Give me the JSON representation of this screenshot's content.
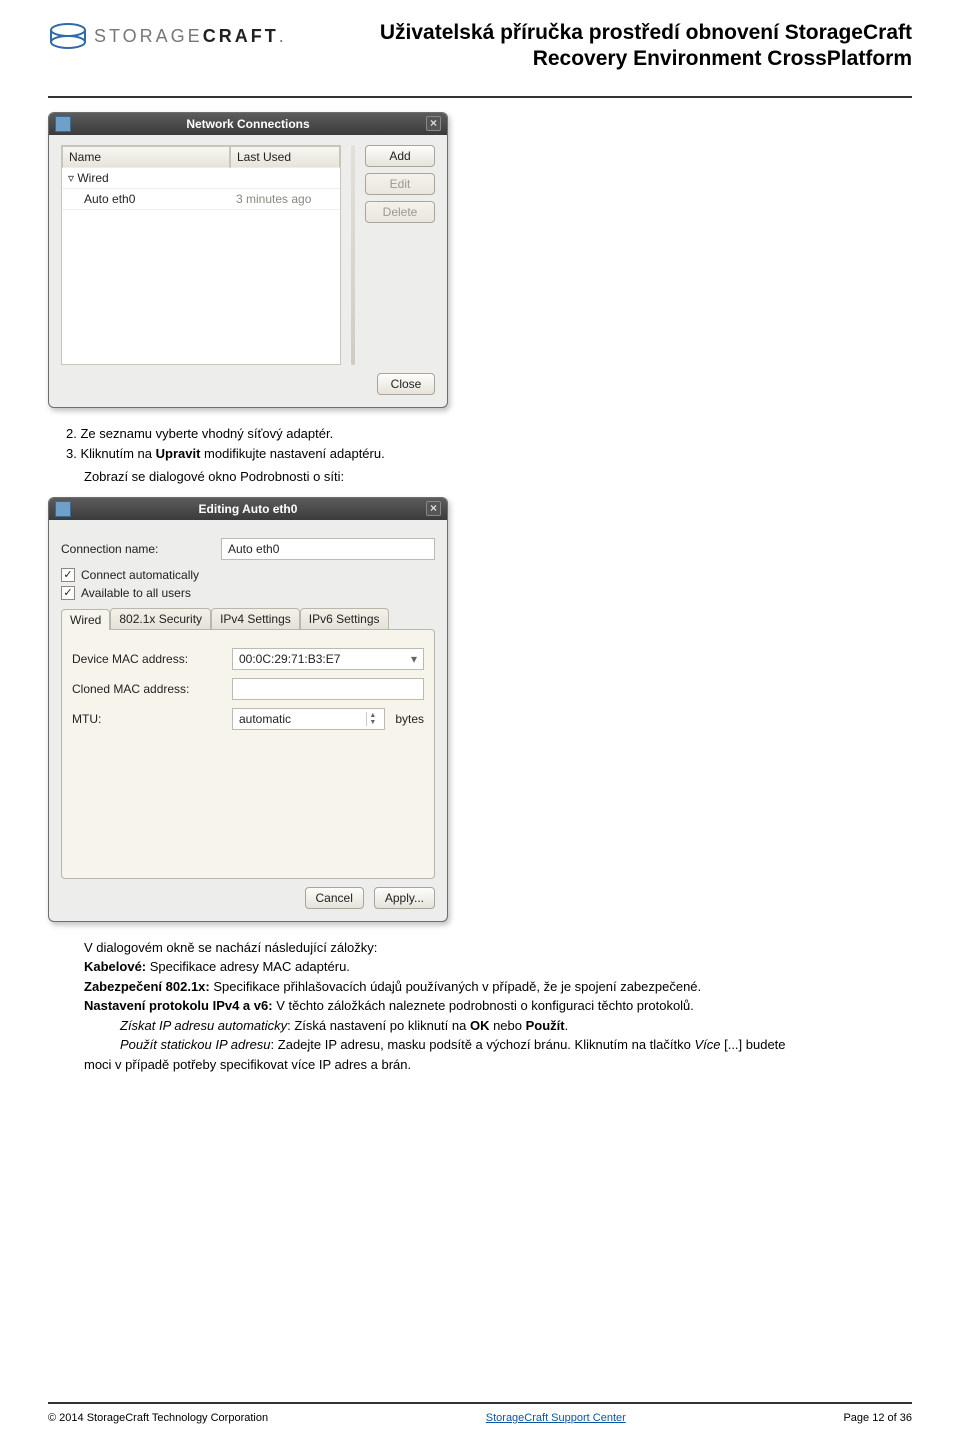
{
  "header": {
    "logo_text_light": "STORAGE",
    "logo_text_bold": "CRAFT",
    "doc_title_line1": "Uživatelská příručka prostředí obnovení StorageCraft",
    "doc_title_line2": "Recovery Environment CrossPlatform"
  },
  "shot1": {
    "title": "Network Connections",
    "col_name": "Name",
    "col_lastused": "Last Used",
    "group": "Wired",
    "item": "Auto eth0",
    "item_time": "3 minutes ago",
    "btn_add": "Add",
    "btn_edit": "Edit",
    "btn_delete": "Delete",
    "btn_close": "Close"
  },
  "body": {
    "step2_num": "2.",
    "step2_text": "Ze seznamu vyberte vhodný síťový adaptér.",
    "step3_num": "3.",
    "step3_pre": "Kliknutím na ",
    "step3_bold": "Upravit",
    "step3_post": " modifikujte nastavení adaptéru.",
    "step3_result": "Zobrazí se dialogové okno Podrobnosti o síti:"
  },
  "shot2": {
    "title": "Editing Auto eth0",
    "lbl_conn_name": "Connection name:",
    "val_conn_name": "Auto eth0",
    "chk_auto": "Connect automatically",
    "chk_users": "Available to all users",
    "tab_wired": "Wired",
    "tab_8021x": "802.1x Security",
    "tab_ipv4": "IPv4 Settings",
    "tab_ipv6": "IPv6 Settings",
    "lbl_dev_mac": "Device MAC address:",
    "val_dev_mac": "00:0C:29:71:B3:E7",
    "lbl_cloned_mac": "Cloned MAC address:",
    "lbl_mtu": "MTU:",
    "val_mtu": "automatic",
    "lbl_bytes": "bytes",
    "btn_cancel": "Cancel",
    "btn_apply": "Apply..."
  },
  "explain": {
    "intro": "V dialogovém okně se nachází následující záložky:",
    "wired_b": "Kabelové:",
    "wired_t": " Specifikace adresy MAC adaptéru.",
    "sec_b": "Zabezpečení 802.1x:",
    "sec_t": " Specifikace přihlašovacích údajů používaných v případě, že je spojení zabezpečené.",
    "ip_b": "Nastavení protokolu IPv4 a v6:",
    "ip_t": " V těchto záložkách naleznete podrobnosti o konfiguraci těchto protokolů.",
    "auto_i": "Získat IP adresu automaticky",
    "auto_mid": ": Získá nastavení po kliknutí na ",
    "auto_ok": "OK",
    "auto_or": " nebo ",
    "auto_use": "Použít",
    "auto_dot": ".",
    "static_i": "Použít statickou IP adresu",
    "static_mid": ": Zadejte IP adresu, masku podsítě a výchozí bránu. Kliknutím na tlačítko ",
    "more_i": "Více",
    "static_post": " [...] budete",
    "last_line": "moci v případě potřeby specifikovat více IP adres a brán."
  },
  "footer": {
    "copyright": "© 2014 StorageCraft Technology Corporation",
    "link": "StorageCraft Support Center",
    "page": "Page 12 of 36"
  }
}
